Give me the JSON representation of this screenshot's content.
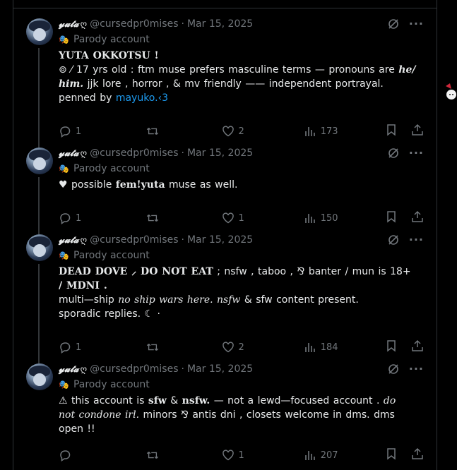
{
  "posts": [
    {
      "display_name": "𝔂𝓾𝓽𝓪",
      "badge": "ღ",
      "handle": "@cursedpr0mises",
      "date": "Mar 15, 2025",
      "parody_label": "Parody account",
      "text": {
        "line1": "YUTA OKKOTSU !",
        "line2a": "⊚ ⁄ 17 yrs old : ftm muse prefers masculine terms — pronouns are ",
        "line2b": "he/",
        "line3a": "him.",
        "line3b": " jjk lore , horror , & mv friendly —— independent portrayal.",
        "line4a": "penned by ",
        "line4b": "mayuko.‹3"
      },
      "replies": "1",
      "reposts": "",
      "likes": "2",
      "views": "173"
    },
    {
      "display_name": "𝔂𝓾𝓽𝓪",
      "badge": "ღ",
      "handle": "@cursedpr0mises",
      "date": "Mar 15, 2025",
      "parody_label": "Parody account",
      "text": {
        "line1a": "♥ possible ",
        "line1b": "fem!yuta",
        "line1c": " muse as well."
      },
      "replies": "1",
      "reposts": "",
      "likes": "1",
      "views": "150"
    },
    {
      "display_name": "𝔂𝓾𝓽𝓪",
      "badge": "ღ",
      "handle": "@cursedpr0mises",
      "date": "Mar 15, 2025",
      "parody_label": "Parody account",
      "text": {
        "line1a": "DEAD DOVE ⸝ DO NOT EAT",
        "line1b": " ; nsfw , taboo , ⅋ banter / mun is 18+",
        "line2": "/ MDNI .",
        "line3a": "multi—ship ",
        "line3b": "no ship wars here. nsfw",
        "line3c": " & sfw content present.",
        "line4": "sporadic replies.   ☾ ·"
      },
      "replies": "1",
      "reposts": "",
      "likes": "2",
      "views": "184"
    },
    {
      "display_name": "𝔂𝓾𝓽𝓪",
      "badge": "ღ",
      "handle": "@cursedpr0mises",
      "date": "Mar 15, 2025",
      "parody_label": "Parody account",
      "text": {
        "line1a": "⚠ this account is ",
        "line1b": "sfw",
        "line1c": " & ",
        "line1d": "nsfw.",
        "line1e": "  — not a lewd—focused account . ",
        "line1f": "do",
        "line2a": "not condone irl.",
        "line2b": " minors ⅋ antis dni , closets welcome in dms. dms",
        "line3": "open !!"
      },
      "replies": "",
      "reposts": "",
      "likes": "1",
      "views": "207"
    }
  ],
  "icons": [
    "reply-icon",
    "repost-icon",
    "like-icon",
    "views-icon",
    "bookmark-icon",
    "share-icon",
    "grok-icon",
    "more-icon",
    "parody-mask-icon"
  ],
  "colors": {
    "background": "#000000",
    "text": "#e7e9ea",
    "muted": "#71767b",
    "link": "#1d9bf0",
    "border": "#2f3336"
  }
}
